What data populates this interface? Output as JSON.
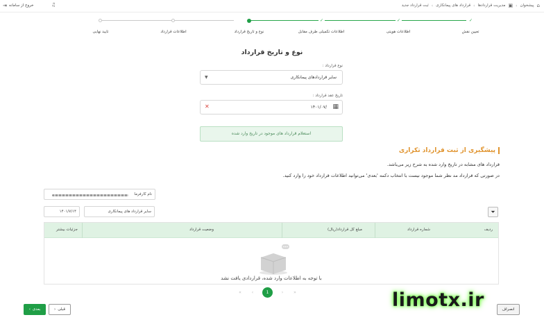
{
  "topbar": {
    "breadcrumbs": [
      "پیشخوان",
      "مدیریت قراردادها",
      "قرارداد های پیمانکاری",
      "ثبت قرارداد جدید"
    ],
    "logout_label": "خروج از سامانه"
  },
  "stepper": {
    "steps": [
      {
        "label": "تعیین نقش",
        "state": "done"
      },
      {
        "label": "اطلاعات هویتی",
        "state": "done"
      },
      {
        "label": "اطلاعات تکمیلی طرف مقابل",
        "state": "done"
      },
      {
        "label": "نوع و تاریخ قرارداد",
        "state": "active"
      },
      {
        "label": "اطلاعات قرارداد",
        "state": "todo"
      },
      {
        "label": "تایید نهایی",
        "state": "todo"
      }
    ],
    "done_color": "#27a74a",
    "active_color": "#1f9e46"
  },
  "form": {
    "title": "نوع و تاریخ قرارداد",
    "type_label": "نوع قرارداد :",
    "type_value": "سایر قراردادهای پیمانکاری",
    "date_label": "تاریخ عقد قرارداد :",
    "date_value": "۱۴۰۱/۰۷/",
    "inquiry_button": "استعلام قرارداد های موجود در تاریخ وارد شده"
  },
  "warning": {
    "title": "پیشگیری از ثبت قرارداد تکراری",
    "line1": "قرارداد های مشابه در تاریخ وارد شده به شرح زیر می‌باشد.",
    "line2": "در صورتی که قرارداد مد نظر شما موجود نیست با انتخاب دکمه 'بعدی' می‌توانید اطلاعات قرارداد خود را وارد کنید.",
    "accent": "#e0932d"
  },
  "filters": {
    "party_label": "نام کارفرما",
    "type_value": "سایر قرارداد های پیمانکاری",
    "date_value": "۱۴۰۱/۷/۱۴"
  },
  "table": {
    "columns": [
      "ردیف",
      "شماره قرارداد",
      "مبلغ کل قرارداد(ریال)",
      "وضعیت قرارداد",
      "جزئیات بیشتر"
    ],
    "empty_text": "با توجه به اطلاعات وارد شده، قراردادی یافت نشد",
    "header_color": "#dff2e3"
  },
  "pagination": {
    "current": "1"
  },
  "buttons": {
    "next": "بعدی",
    "prev": "قبلی",
    "cancel": "انصراف"
  },
  "watermark": "limotx.ir"
}
